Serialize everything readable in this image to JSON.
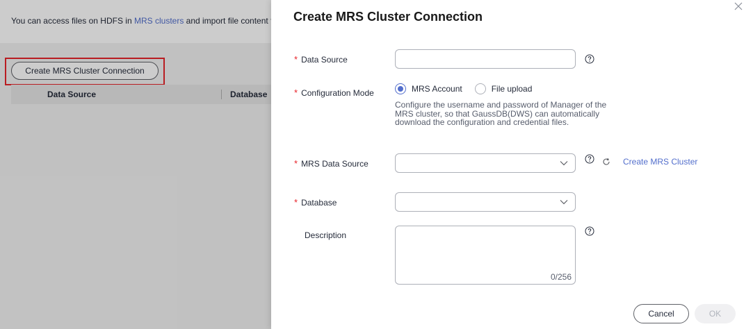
{
  "background": {
    "info_prefix": "You can access files on HDFS in ",
    "info_link": "MRS clusters",
    "info_suffix": " and import file content t",
    "create_button_label": "Create MRS Cluster Connection",
    "table_columns": [
      "Data Source",
      "Database"
    ]
  },
  "drawer": {
    "title": "Create MRS Cluster Connection",
    "fields": {
      "data_source": {
        "label": "Data Source",
        "value": ""
      },
      "configuration_mode": {
        "label": "Configuration Mode",
        "options": [
          "MRS Account",
          "File upload"
        ],
        "selected": "MRS Account",
        "description": "Configure the username and password of Manager of the MRS cluster, so that GaussDB(DWS) can automatically download the configuration and credential files."
      },
      "mrs_data_source": {
        "label": "MRS Data Source",
        "value": "",
        "create_link": "Create MRS Cluster"
      },
      "database": {
        "label": "Database",
        "value": ""
      },
      "description": {
        "label": "Description",
        "value": "",
        "counter": "0/256"
      }
    },
    "buttons": {
      "cancel": "Cancel",
      "ok": "OK"
    }
  },
  "colors": {
    "accent": "#526ecc",
    "required": "#e8232a",
    "highlight_box": "#e8232a",
    "disabled_text": "#b0b4bc"
  },
  "icons": {
    "close": "close-icon",
    "help": "help-circle-icon",
    "refresh": "refresh-icon",
    "dropdown": "chevron-down-icon"
  }
}
